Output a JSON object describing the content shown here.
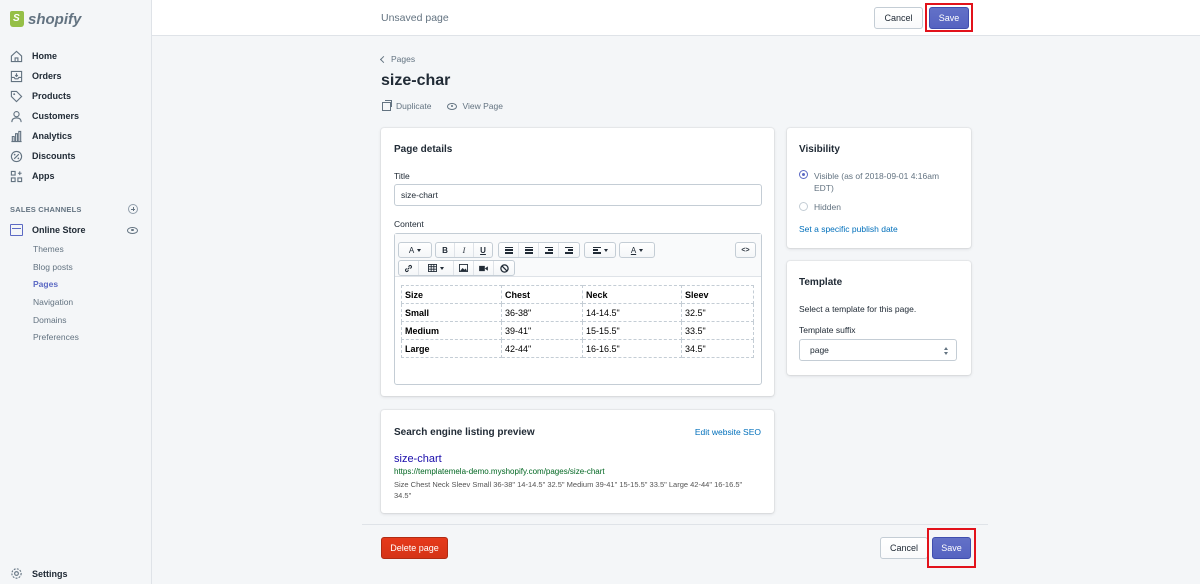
{
  "brand": {
    "logo_text": "shopify"
  },
  "sidebar": {
    "items": [
      {
        "label": "Home",
        "icon": "home-icon"
      },
      {
        "label": "Orders",
        "icon": "orders-icon"
      },
      {
        "label": "Products",
        "icon": "tag-icon"
      },
      {
        "label": "Customers",
        "icon": "person-icon"
      },
      {
        "label": "Analytics",
        "icon": "bar-chart-icon"
      },
      {
        "label": "Discounts",
        "icon": "discount-icon"
      },
      {
        "label": "Apps",
        "icon": "apps-icon"
      }
    ],
    "channels_heading": "SALES CHANNELS",
    "online_store": "Online Store",
    "sub_items": [
      "Themes",
      "Blog posts",
      "Pages",
      "Navigation",
      "Domains",
      "Preferences"
    ],
    "active_sub_item": "Pages",
    "settings": "Settings"
  },
  "topbar": {
    "status": "Unsaved page",
    "cancel_label": "Cancel",
    "save_label": "Save"
  },
  "page": {
    "breadcrumb": "Pages",
    "title": "size-char",
    "duplicate_label": "Duplicate",
    "view_label": "View Page"
  },
  "details": {
    "heading": "Page details",
    "title_label": "Title",
    "title_value": "size-chart",
    "content_label": "Content",
    "toolbar": {
      "font": "A",
      "bold": "B",
      "italic": "I",
      "underline": "U",
      "color": "A",
      "code": "<>"
    },
    "table": {
      "headers": [
        "Size",
        "Chest",
        "Neck",
        "Sleev"
      ],
      "rows": [
        [
          "Small",
          "36-38\"",
          "14-14.5\"",
          "32.5\""
        ],
        [
          "Medium",
          "39-41\"",
          "15-15.5\"",
          "33.5\""
        ],
        [
          "Large",
          "42-44\"",
          "16-16.5\"",
          "34.5\""
        ]
      ]
    }
  },
  "visibility": {
    "heading": "Visibility",
    "visible_line1": "Visible (as of 2018-09-01 4:16am",
    "visible_line2": "EDT)",
    "hidden": "Hidden",
    "publish_link": "Set a specific publish date",
    "selected": "Visible"
  },
  "template": {
    "heading": "Template",
    "description": "Select a template for this page.",
    "suffix_label": "Template suffix",
    "suffix_value": "page"
  },
  "seo": {
    "heading": "Search engine listing preview",
    "edit_link": "Edit website SEO",
    "preview_title": "size-chart",
    "preview_url": "https://templatemela-demo.myshopify.com/pages/size-chart",
    "preview_desc": "Size Chest Neck Sleev Small 36-38\" 14-14.5\" 32.5\" Medium 39-41\" 15-15.5\" 33.5\" Large 42-44\" 16-16.5\" 34.5\""
  },
  "footer": {
    "delete_label": "Delete page",
    "cancel_label": "Cancel",
    "save_label": "Save"
  },
  "colors": {
    "primary": "#5c6ac4",
    "danger": "#de3618",
    "highlight": "#e2121b",
    "link": "#006fbb"
  }
}
